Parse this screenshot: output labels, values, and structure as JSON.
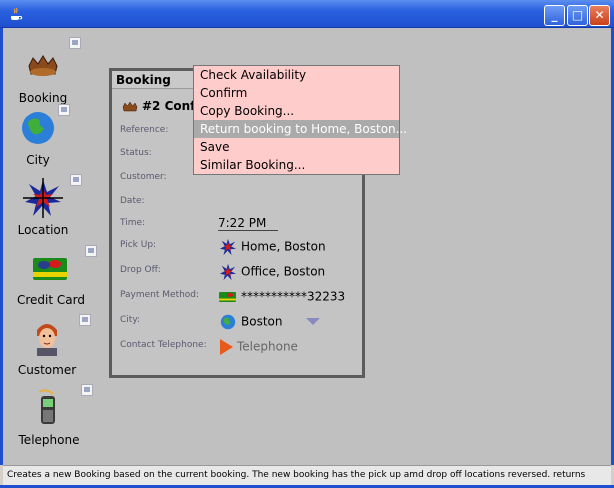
{
  "desktop": {
    "icons": [
      {
        "label": "Booking",
        "icon": "booking-icon"
      },
      {
        "label": "City",
        "icon": "globe-icon"
      },
      {
        "label": "Location",
        "icon": "location-icon"
      },
      {
        "label": "Credit Card",
        "icon": "credit-card-icon"
      },
      {
        "label": "Customer",
        "icon": "customer-icon"
      },
      {
        "label": "Telephone",
        "icon": "telephone-icon"
      }
    ]
  },
  "booking_window": {
    "title": "Booking",
    "heading": "#2 Confir",
    "fields": {
      "reference_label": "Reference:",
      "status_label": "Status:",
      "customer_label": "Customer:",
      "date_label": "Date:",
      "time_label": "Time:",
      "time_value": "7:22 PM",
      "pickup_label": "Pick Up:",
      "pickup_value": "Home, Boston",
      "dropoff_label": "Drop Off:",
      "dropoff_value": "Office, Boston",
      "payment_label": "Payment Method:",
      "payment_value": "***********32233",
      "city_label": "City:",
      "city_value": "Boston",
      "telephone_label": "Contact Telephone:",
      "telephone_value": "Telephone"
    }
  },
  "popup_menu": {
    "items": [
      "Check Availability",
      "Confirm",
      "Copy Booking...",
      "Return booking to Home, Boston...",
      "Save",
      "Similar Booking..."
    ],
    "selected_index": 3
  },
  "status_bar": {
    "text": "Creates a new Booking based on the current booking.  The new booking has the pick up amd drop off locations reversed. returns"
  },
  "colors": {
    "menu_bg": "#ffcccc",
    "menu_selected": "#aaaaaa",
    "xp_blue": "#1f4fcf"
  }
}
